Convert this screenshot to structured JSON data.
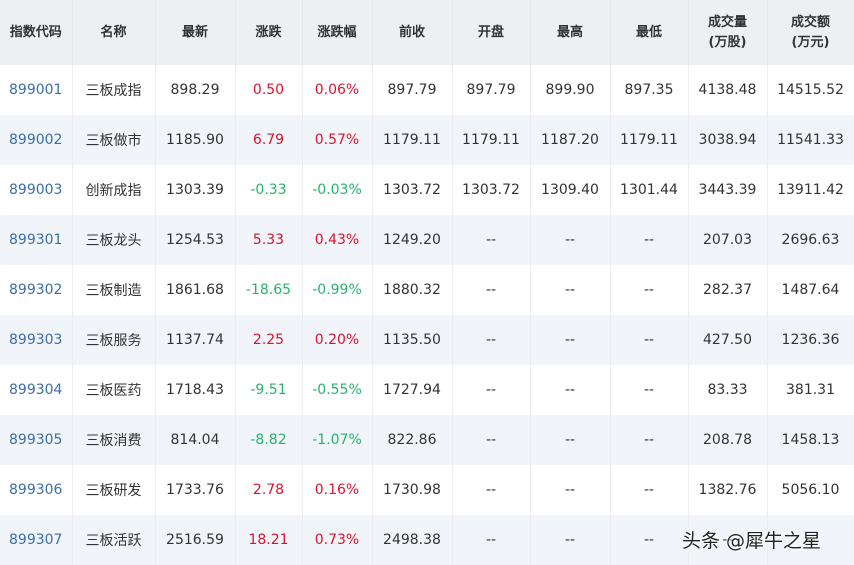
{
  "headers": [
    "指数代码",
    "名称",
    "最新",
    "涨跌",
    "涨跌幅",
    "前收",
    "开盘",
    "最高",
    "最低",
    "成交量\n(万股)",
    "成交额\n(万元)"
  ],
  "colors": {
    "up": "#d9142f",
    "down": "#27b36d",
    "code": "#3b6ea8"
  },
  "rows": [
    [
      "899001",
      "三板成指",
      "898.29",
      "0.50",
      "0.06%",
      "897.79",
      "897.79",
      "899.90",
      "897.35",
      "4138.48",
      "14515.52"
    ],
    [
      "899002",
      "三板做市",
      "1185.90",
      "6.79",
      "0.57%",
      "1179.11",
      "1179.11",
      "1187.20",
      "1179.11",
      "3038.94",
      "11541.33"
    ],
    [
      "899003",
      "创新成指",
      "1303.39",
      "-0.33",
      "-0.03%",
      "1303.72",
      "1303.72",
      "1309.40",
      "1301.44",
      "3443.39",
      "13911.42"
    ],
    [
      "899301",
      "三板龙头",
      "1254.53",
      "5.33",
      "0.43%",
      "1249.20",
      "--",
      "--",
      "--",
      "207.03",
      "2696.63"
    ],
    [
      "899302",
      "三板制造",
      "1861.68",
      "-18.65",
      "-0.99%",
      "1880.32",
      "--",
      "--",
      "--",
      "282.37",
      "1487.64"
    ],
    [
      "899303",
      "三板服务",
      "1137.74",
      "2.25",
      "0.20%",
      "1135.50",
      "--",
      "--",
      "--",
      "427.50",
      "1236.36"
    ],
    [
      "899304",
      "三板医药",
      "1718.43",
      "-9.51",
      "-0.55%",
      "1727.94",
      "--",
      "--",
      "--",
      "83.33",
      "381.31"
    ],
    [
      "899305",
      "三板消费",
      "814.04",
      "-8.82",
      "-1.07%",
      "822.86",
      "--",
      "--",
      "--",
      "208.78",
      "1458.13"
    ],
    [
      "899306",
      "三板研发",
      "1733.76",
      "2.78",
      "0.16%",
      "1730.98",
      "--",
      "--",
      "--",
      "1382.76",
      "5056.10"
    ],
    [
      "899307",
      "三板活跃",
      "2516.59",
      "18.21",
      "0.73%",
      "2498.38",
      "--",
      "--",
      "--",
      "--",
      "--"
    ]
  ],
  "watermark": "头条 @犀牛之星"
}
